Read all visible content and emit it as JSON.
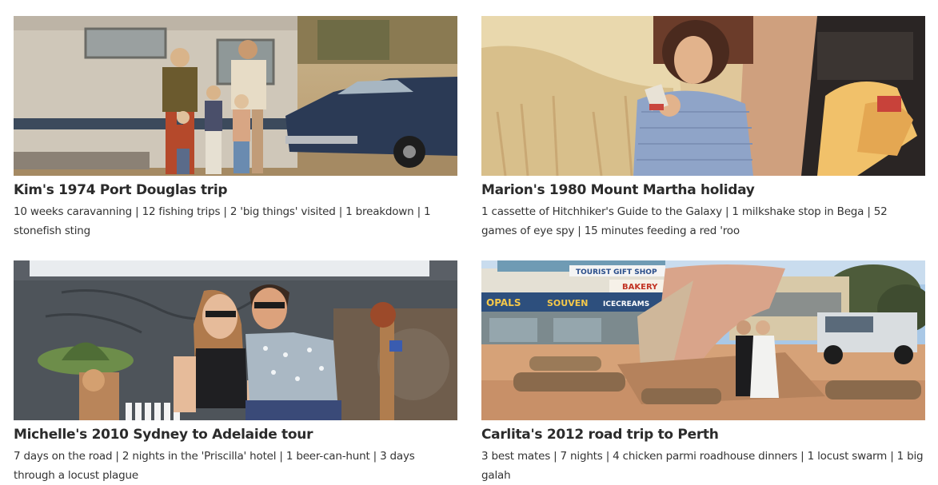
{
  "trips": [
    {
      "title": "Kim's 1974 Port Douglas trip",
      "stats": "10 weeks caravanning | 12 fishing trips | 2 'big things' visited | 1 breakdown | 1 stonefish sting",
      "photo_icon": "family-caravan-photo"
    },
    {
      "title": "Marion's 1980 Mount Martha holiday",
      "stats": "1 cassette of Hitchhiker's Guide to the Galaxy | 1 milkshake stop in Bega | 52 games of eye spy | 15 minutes feeding a red 'roo",
      "photo_icon": "girl-drinking-photo"
    },
    {
      "title": "Michelle's 2010 Sydney to Adelaide tour",
      "stats": "7 days on the road | 2 nights in the 'Priscilla' hotel | 1 beer-can-hunt | 3 days through a locust plague",
      "photo_icon": "couple-sitting-photo"
    },
    {
      "title": "Carlita's 2012 road trip to Perth",
      "stats": "3 best mates | 7 nights | 4 chicken parmi roadhouse dinners | 1 locust swarm | 1 big galah",
      "photo_icon": "roadhouse-photo"
    }
  ],
  "signs": {
    "tourist_shop": "TOURIST GIFT SHOP",
    "bakery": "BAKERY",
    "opals": "OPALS",
    "souvenirs": "SOUVEN",
    "ice_creams": "ICECREAMS"
  },
  "colors": {
    "title": "#2b2b2b",
    "text": "#333333",
    "background": "#ffffff"
  }
}
